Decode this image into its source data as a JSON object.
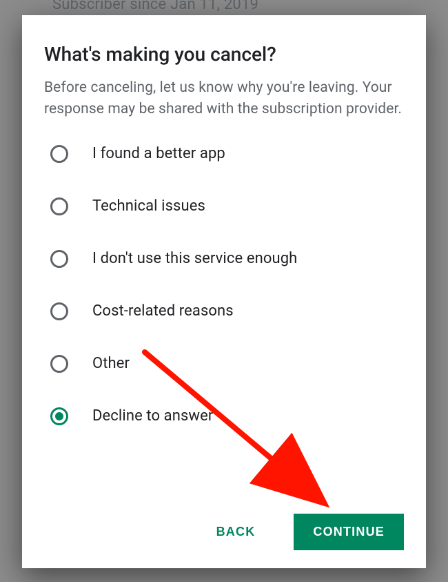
{
  "peek": "Subscriber since Jan 11, 2019",
  "dialog": {
    "title": "What's making you cancel?",
    "subtitle": "Before canceling, let us know why you're leaving. Your response may be shared with the subscription provider.",
    "options": [
      {
        "label": "I found a better app",
        "selected": false
      },
      {
        "label": "Technical issues",
        "selected": false
      },
      {
        "label": "I don't use this service enough",
        "selected": false
      },
      {
        "label": "Cost-related reasons",
        "selected": false
      },
      {
        "label": "Other",
        "selected": false
      },
      {
        "label": "Decline to answer",
        "selected": true
      }
    ],
    "actions": {
      "back": "BACK",
      "continue": "CONTINUE"
    }
  },
  "colors": {
    "accent": "#00875f",
    "arrow": "#ff1400"
  }
}
